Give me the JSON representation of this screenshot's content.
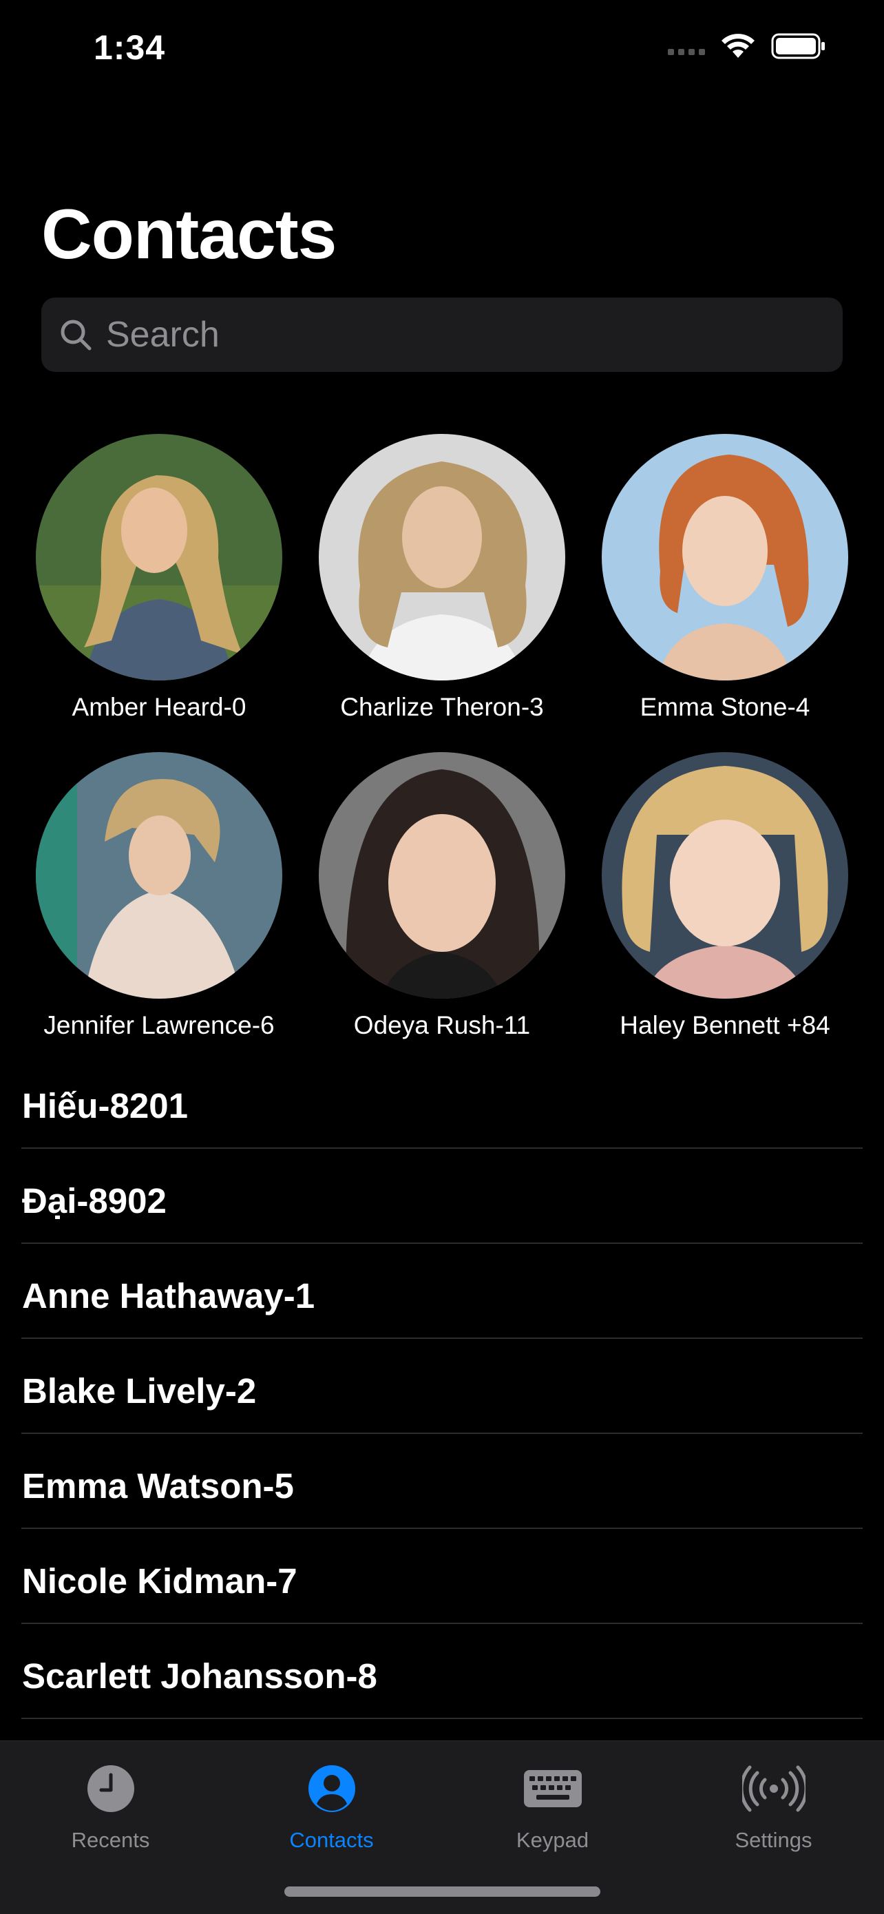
{
  "status_bar": {
    "time": "1:34"
  },
  "header": {
    "title": "Contacts"
  },
  "search": {
    "placeholder": "Search",
    "value": ""
  },
  "favorites": [
    {
      "name": "Amber Heard-0",
      "hair_color": "#c9a86a",
      "bg_color": "#4a6b3a",
      "icon": "avatar-photo"
    },
    {
      "name": "Charlize Theron-3",
      "hair_color": "#b89a6a",
      "bg_color": "#d8d8d8",
      "icon": "avatar-photo"
    },
    {
      "name": "Emma Stone-4",
      "hair_color": "#c96a35",
      "bg_color": "#a8cbe8",
      "icon": "avatar-photo"
    },
    {
      "name": "Jennifer Lawrence-6",
      "hair_color": "#c8a872",
      "bg_color": "#5c7a8a",
      "icon": "avatar-photo"
    },
    {
      "name": "Odeya Rush-11",
      "hair_color": "#2b2220",
      "bg_color": "#7a7a7a",
      "icon": "avatar-photo"
    },
    {
      "name": "Haley Bennett +84",
      "hair_color": "#d9b87a",
      "bg_color": "#3a4a5a",
      "icon": "avatar-photo"
    }
  ],
  "contacts": [
    "Hiếu-8201",
    "Đại-8902",
    "Anne Hathaway-1",
    "Blake Lively-2",
    "Emma Watson-5",
    "Nicole Kidman-7",
    "Scarlett Johansson-8"
  ],
  "tab_bar": {
    "tabs": [
      {
        "label": "Recents",
        "icon": "clock-icon",
        "active": false
      },
      {
        "label": "Contacts",
        "icon": "person-circle-icon",
        "active": true
      },
      {
        "label": "Keypad",
        "icon": "keyboard-icon",
        "active": false
      },
      {
        "label": "Settings",
        "icon": "broadcast-icon",
        "active": false
      }
    ]
  },
  "colors": {
    "accent": "#0a84ff",
    "background": "#000000",
    "surface": "#1c1c1e",
    "secondary_text": "#8e8e93"
  }
}
